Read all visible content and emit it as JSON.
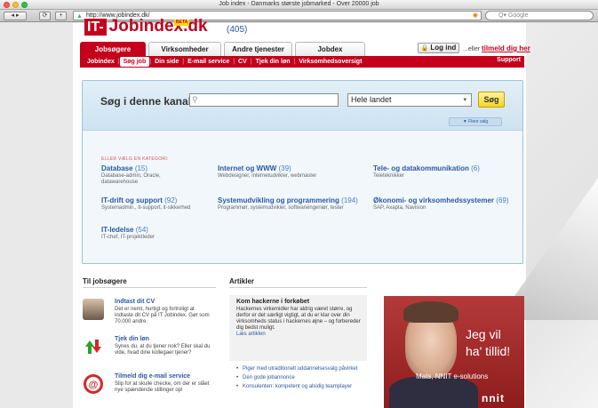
{
  "browser": {
    "title": "Job index - Danmarks største jobmarked - Over 20000 job",
    "url": "http://www.jobindex.dk/",
    "search_placeholder": "Q▾ Google"
  },
  "site": {
    "logo_it": "IT-",
    "logo_name": "Jobindex.dk",
    "beta": "BETA",
    "count": "(405)"
  },
  "tabs": [
    {
      "label": "Jobsøgere"
    },
    {
      "label": "Virksomheder"
    },
    {
      "label": "Andre tjenester"
    },
    {
      "label": "Jobdex"
    }
  ],
  "login": {
    "button": "Log ind",
    "hint": "...eller",
    "register": "tilmeld dig her"
  },
  "nav": {
    "items": [
      {
        "label": "Jobindex"
      },
      {
        "label": "Søg job"
      },
      {
        "label": "Din side"
      },
      {
        "label": "E-mail service"
      },
      {
        "label": "CV"
      },
      {
        "label": "Tjek din løn"
      },
      {
        "label": "Virksomhedsoversigt"
      }
    ],
    "support": "Support"
  },
  "search": {
    "label": "Søg i denne kanal:",
    "keyword_value": "",
    "region": "Hele landet",
    "button": "Søg",
    "more": "▼ Flere valg"
  },
  "categories": {
    "hint": "ELLER VÆLG EN KATEGORI:",
    "items": [
      {
        "title": "Database",
        "count": "(15)",
        "desc1": "Database-admin, Oracle,",
        "desc2": "datawarehouse"
      },
      {
        "title": "Internet og WWW",
        "count": "(39)",
        "desc1": "Webdesigner, internetudvikler, webmaster",
        "desc2": ""
      },
      {
        "title": "Tele- og datakommunikation",
        "count": "(6)",
        "desc1": "Teleteknikker",
        "desc2": ""
      },
      {
        "title": "IT-drift og support",
        "count": "(92)",
        "desc1": "Systemadmin., it-support, it-sikkerhed",
        "desc2": ""
      },
      {
        "title": "Systemudvikling og programmering",
        "count": "(194)",
        "desc1": "Programmør, systemudvikler, softwareingeniør, tester",
        "desc2": ""
      },
      {
        "title": "Økonomi- og virksomhedssystemer",
        "count": "(69)",
        "desc1": "SAP, Axapta, Navision",
        "desc2": ""
      },
      {
        "title": "IT-ledelse",
        "count": "(54)",
        "desc1": "IT-chef, IT-projektleder",
        "desc2": ""
      }
    ]
  },
  "jobseekers": {
    "heading": "Til jobsøgere",
    "items": [
      {
        "title": "Indtast dit CV",
        "desc": "Det er nemt, hurtigt og fortroligt at indtaste dit CV på IT Jobindex. Gør som 70.000 andre."
      },
      {
        "title": "Tjek din løn",
        "desc": "Synes du, at du tjener nok? Eller skal du vide, hvad dine kollegaer tjener?"
      },
      {
        "title": "Tilmeld dig e-mail service",
        "desc": "Slip for at skulle checke, om der er slået nye spændende stillinger op!"
      }
    ]
  },
  "articles": {
    "heading": "Artikler",
    "featured_title": "Kom hackerne i forkøbet",
    "featured_body": "Hackernes virkemidler har aldrig været større, og derfor er det særligt vigtigt, at du er klar over din virksomheds status i hackernes øjne – og forbereder dig bedst muligt.",
    "featured_link": "Læs artiklen",
    "list": [
      {
        "label": "Piger med utraditionelt uddannelsesvalg påvirket"
      },
      {
        "label": "Den gode jobannonce"
      },
      {
        "label": "Konsulenten: kompetent og alsidig teamplayer"
      }
    ]
  },
  "ad": {
    "line1": "Jeg vil",
    "line2": "ha' tillid!",
    "caption": "Mats, NNIT e-solutions",
    "logo": "nnit"
  },
  "colors": {
    "brand_red": "#c4001c",
    "link_blue": "#2a5aa0",
    "search_yellow": "#f5d71f"
  }
}
